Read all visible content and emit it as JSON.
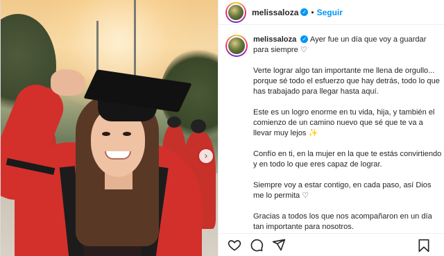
{
  "post": {
    "username": "melissaloza",
    "follow_label": "Seguir",
    "separator": "•",
    "verified_glyph": "✓",
    "carousel_next_glyph": "›",
    "caption_username": "melissaloza",
    "caption_paragraphs": [
      "Ayer fue un día que voy a guardar para siempre ♡",
      "Verte lograr algo tan importante me llena de orgullo... porque sé todo el esfuerzo que hay detrás, todo lo que has trabajado para llegar hasta aquí.",
      "Este es un logro enorme en tu vida, hija, y también el comienzo de un camino nuevo que sé que te va a llevar muy lejos ✨",
      "Confío en ti, en la mujer en la que te estás convirtiendo y en todo lo que eres capaz de lograr.",
      "Siempre voy a estar contigo, en cada paso, así Dios me lo permita ♡",
      "Gracias a todos los que nos acompañaron en un día tan importante para nosotros."
    ]
  },
  "icons": {
    "like": "heart-icon",
    "comment": "comment-icon",
    "share": "share-icon",
    "save": "bookmark-icon",
    "next": "chevron-right-icon",
    "verified": "verified-badge-icon"
  },
  "colors": {
    "accent": "#0095f6",
    "text": "#262626",
    "gown": "#d3302b"
  }
}
